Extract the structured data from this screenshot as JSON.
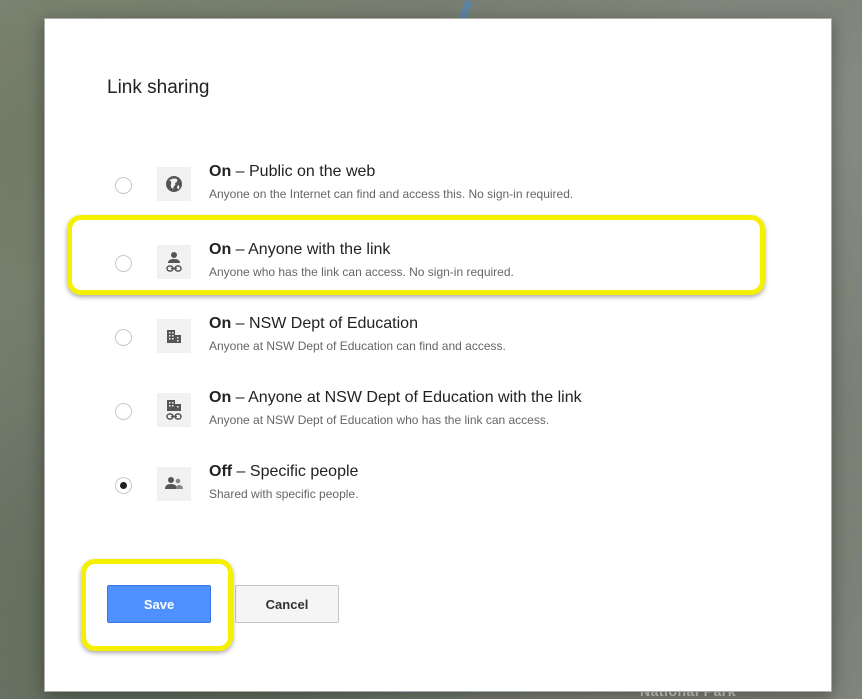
{
  "dialog": {
    "title": "Link sharing",
    "options": [
      {
        "bold": "On",
        "rest": " – Public on the web",
        "desc": "Anyone on the Internet can find and access this. No sign-in required.",
        "icon": "globe-icon",
        "selected": false
      },
      {
        "bold": "On",
        "rest": " – Anyone with the link",
        "desc": "Anyone who has the link can access. No sign-in required.",
        "icon": "person-link-icon",
        "selected": false
      },
      {
        "bold": "On",
        "rest": " – NSW Dept of Education",
        "desc": "Anyone at NSW Dept of Education can find and access.",
        "icon": "building-icon",
        "selected": false
      },
      {
        "bold": "On",
        "rest": " – Anyone at NSW Dept of Education with the link",
        "desc": "Anyone at NSW Dept of Education who has the link can access.",
        "icon": "building-link-icon",
        "selected": false
      },
      {
        "bold": "Off",
        "rest": " – Specific people",
        "desc": "Shared with specific people.",
        "icon": "people-icon",
        "selected": true
      }
    ],
    "save_label": "Save",
    "cancel_label": "Cancel"
  },
  "background": {
    "map_label": "National Park"
  },
  "colors": {
    "highlight": "#f4f000",
    "save_button": "#4d90fe"
  }
}
